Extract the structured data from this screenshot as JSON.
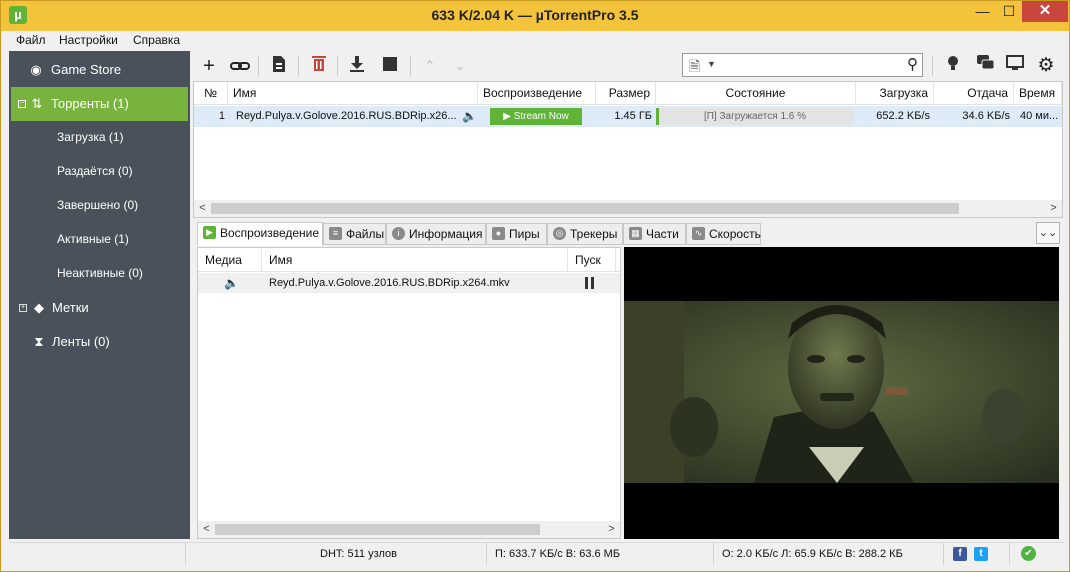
{
  "window": {
    "title": "633 K/2.04 K — µTorrentPro 3.5",
    "app_icon": "utorrent-logo-icon",
    "controls": {
      "minimize": "—",
      "maximize": "☐",
      "close": "✕"
    }
  },
  "menu": [
    "Файл",
    "Настройки",
    "Справка"
  ],
  "sidebar": {
    "items": [
      {
        "label": "Game Store",
        "icon": "gamepad-icon"
      },
      {
        "label": "Торренты (1)",
        "icon": "torrents-arrows-icon",
        "selected": true
      },
      {
        "label": "Загрузка (1)"
      },
      {
        "label": "Раздаётся (0)"
      },
      {
        "label": "Завершено (0)"
      },
      {
        "label": "Активные (1)"
      },
      {
        "label": "Неактивные (0)"
      },
      {
        "label": "Метки",
        "icon": "tag-icon"
      },
      {
        "label": "Ленты (0)",
        "icon": "rss-icon"
      }
    ]
  },
  "toolbar": {
    "search_placeholder": "",
    "icons": [
      "add-torrent-icon",
      "add-link-icon",
      "create-torrent-icon",
      "remove-icon",
      "start-download-icon",
      "stop-icon",
      "move-up-icon",
      "move-down-icon",
      "bulb-icon",
      "chat-icon",
      "remote-icon",
      "settings-icon"
    ]
  },
  "torrent_list": {
    "columns": [
      "№",
      "Имя",
      "Воспроизведение",
      "Размер",
      "Состояние",
      "Загрузка",
      "Отдача",
      "Время"
    ],
    "rows": [
      {
        "num": "1",
        "name": "Reyd.Pulya.v.Golove.2016.RUS.BDRip.x26...",
        "stream_label": "▶ Stream Now",
        "size": "1.45 ГБ",
        "status": "[П] Загружается 1.6 %",
        "progress": 0.016,
        "download": "652.2 KБ/s",
        "upload": "34.6 KБ/s",
        "time": "40 ми..."
      }
    ]
  },
  "tabs": [
    {
      "label": "Воспроизведение",
      "active": true
    },
    {
      "label": "Файлы"
    },
    {
      "label": "Информация"
    },
    {
      "label": "Пиры"
    },
    {
      "label": "Трекеры"
    },
    {
      "label": "Части"
    },
    {
      "label": "Скорость"
    }
  ],
  "media_list": {
    "columns": [
      "Медиа",
      "Имя",
      "Пуск"
    ],
    "rows": [
      {
        "name": "Reyd.Pulya.v.Golove.2016.RUS.BDRip.x264.mkv"
      }
    ]
  },
  "status_bar": {
    "dht": "DHT: 511 узлов",
    "download": "П: 633.7 KБ/с В: 63.6 МБ",
    "upload": "О: 2.0 KБ/с Л: 65.9 KБ/с В: 288.2 КБ"
  },
  "colors": {
    "accent": "#5fb336",
    "title_bar": "#f3c33c",
    "sidebar": "#49525a",
    "close": "#c9463d"
  }
}
